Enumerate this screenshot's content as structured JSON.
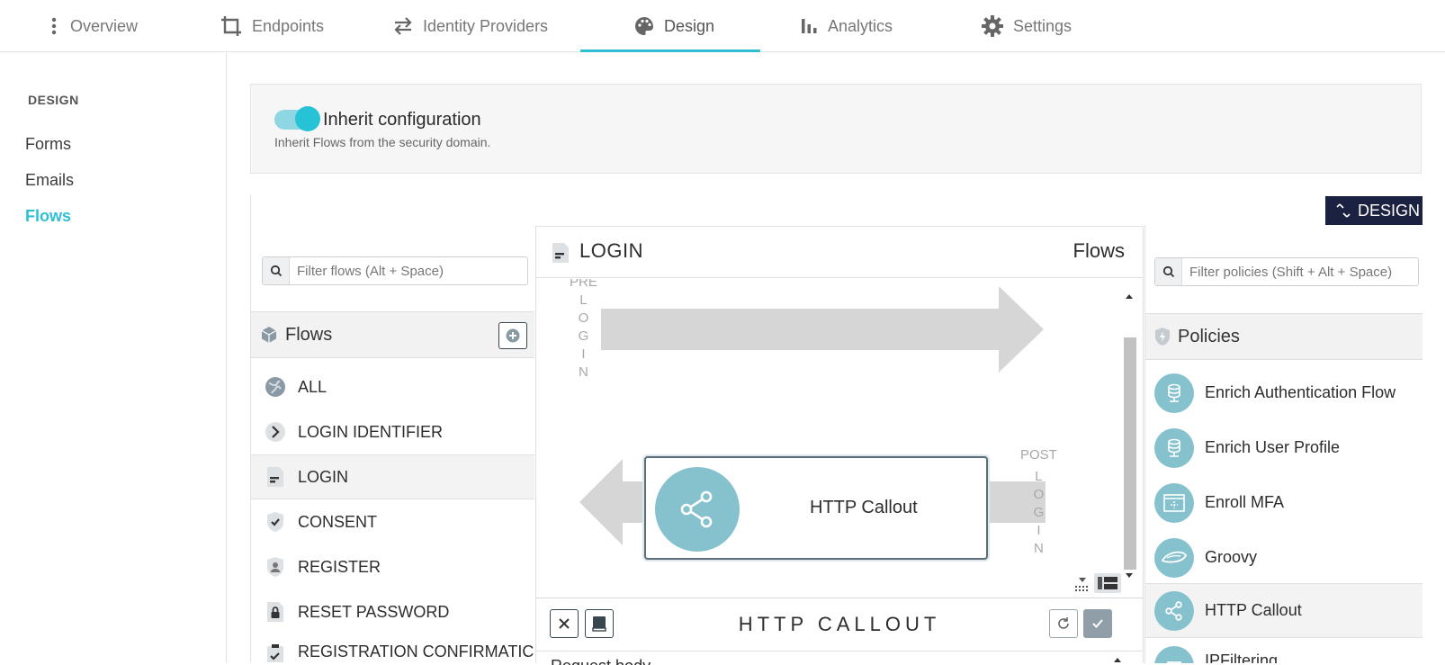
{
  "nav": {
    "tabs": [
      {
        "label": "Overview",
        "icon": "kebab-icon"
      },
      {
        "label": "Endpoints",
        "icon": "crop-icon"
      },
      {
        "label": "Identity Providers",
        "icon": "swap-arrows-icon"
      },
      {
        "label": "Design",
        "icon": "palette-icon",
        "active": true
      },
      {
        "label": "Analytics",
        "icon": "bar-chart-icon"
      },
      {
        "label": "Settings",
        "icon": "gear-icon"
      }
    ],
    "accent": "#2ebfd4"
  },
  "sidebar": {
    "heading": "DESIGN",
    "items": [
      {
        "label": "Forms"
      },
      {
        "label": "Emails"
      },
      {
        "label": "Flows",
        "active": true
      }
    ]
  },
  "inherit": {
    "title": "Inherit configuration",
    "description": "Inherit Flows from the security domain.",
    "enabled": true
  },
  "studio": {
    "mode_label": "DESIGN",
    "flows": {
      "search_placeholder": "Filter flows (Alt + Space)",
      "heading": "Flows",
      "items": [
        {
          "label": "ALL",
          "icon": "globe-icon"
        },
        {
          "label": "LOGIN IDENTIFIER",
          "icon": "chevron-right-icon"
        },
        {
          "label": "LOGIN",
          "icon": "document-icon",
          "selected": true
        },
        {
          "label": "CONSENT",
          "icon": "shield-check-icon"
        },
        {
          "label": "REGISTER",
          "icon": "shield-user-icon"
        },
        {
          "label": "RESET PASSWORD",
          "icon": "lock-icon"
        },
        {
          "label": "REGISTRATION CONFIRMATIC",
          "icon": "clipboard-check-icon"
        }
      ]
    },
    "canvas": {
      "title": "LOGIN",
      "right_label": "Flows",
      "pre_label": "PRE",
      "pre_vertical": [
        "L",
        "O",
        "G",
        "I",
        "N"
      ],
      "post_label": "POST",
      "post_vertical": [
        "L",
        "O",
        "G",
        "I",
        "N"
      ],
      "node_label": "HTTP Callout"
    },
    "editor": {
      "title": "HTTP CALLOUT",
      "sub_label": "Request body"
    },
    "policies": {
      "search_placeholder": "Filter policies (Shift + Alt + Space)",
      "heading": "Policies",
      "items": [
        {
          "label": "Enrich Authentication Flow",
          "icon": "database-icon"
        },
        {
          "label": "Enrich User Profile",
          "icon": "database-icon"
        },
        {
          "label": "Enroll MFA",
          "icon": "window-icon"
        },
        {
          "label": "Groovy",
          "icon": "groovy-icon"
        },
        {
          "label": "HTTP Callout",
          "icon": "share-icon",
          "selected": true
        },
        {
          "label": "IPFiltering",
          "icon": "filter-icon"
        }
      ]
    }
  }
}
